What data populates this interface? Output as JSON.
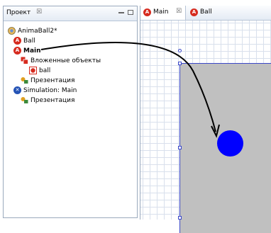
{
  "project_panel": {
    "tab_label": "Проект",
    "close_glyph": "☒",
    "tree": [
      {
        "label": "AnimaBall2*",
        "icon": "project-icon",
        "bold": false
      },
      {
        "label": "Ball",
        "icon": "agent-class-icon",
        "bold": false
      },
      {
        "label": "Main",
        "icon": "agent-class-icon",
        "bold": true
      },
      {
        "label": "Вложенные объекты",
        "icon": "embedded-objects-icon",
        "bold": false
      },
      {
        "label": "ball",
        "icon": "agent-instance-icon",
        "bold": false
      },
      {
        "label": "Презентация",
        "icon": "presentation-icon",
        "bold": false
      },
      {
        "label": "Simulation: Main",
        "icon": "experiment-icon",
        "bold": false
      },
      {
        "label": "Презентация",
        "icon": "presentation-icon",
        "bold": false
      }
    ]
  },
  "editor": {
    "tabs": [
      {
        "label": "Main",
        "active": true,
        "close_glyph": "☒"
      },
      {
        "label": "Ball",
        "active": false
      }
    ]
  },
  "colors": {
    "ball": "#0000ff",
    "frame": "#c0c0c0",
    "frame_border": "#3b48c8",
    "agent_icon": "#d62b1f",
    "experiment_icon": "#2453b5"
  }
}
